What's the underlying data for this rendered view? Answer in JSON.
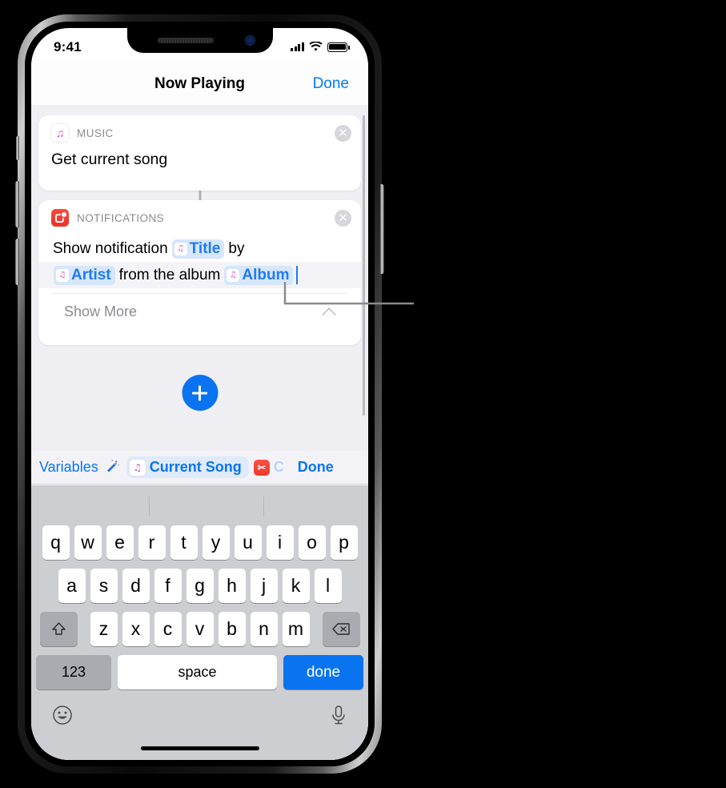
{
  "status_bar": {
    "time": "9:41",
    "signal_icon": "cellular-bars-icon",
    "wifi_icon": "wifi-icon",
    "battery_icon": "battery-full-icon"
  },
  "nav_bar": {
    "title": "Now Playing",
    "done_label": "Done"
  },
  "actions": [
    {
      "app_name": "MUSIC",
      "app_icon": "music-app-icon",
      "icon_glyph": "♫",
      "action_text": "Get current song",
      "close_label": "✕"
    },
    {
      "app_name": "NOTIFICATIONS",
      "app_icon": "notifications-app-icon",
      "close_label": "✕",
      "line1": [
        {
          "type": "text",
          "value": "Show notification"
        },
        {
          "type": "token",
          "value": "Title",
          "icon": "music-note-icon",
          "glyph": "♫"
        },
        {
          "type": "text",
          "value": "by"
        }
      ],
      "line2": [
        {
          "type": "token",
          "value": "Artist",
          "icon": "music-note-icon",
          "glyph": "♫"
        },
        {
          "type": "text",
          "value": "from the album"
        },
        {
          "type": "token",
          "value": "Album",
          "icon": "music-note-icon",
          "glyph": "♫"
        }
      ],
      "show_more_label": "Show More",
      "show_more_chevron": "chevron-up-icon"
    }
  ],
  "add_button": {
    "label": "+",
    "icon": "plus-icon"
  },
  "variables_toolbar": {
    "label": "Variables",
    "magic_wand_icon": "magic-wand-icon",
    "magic_wand_glyph": "🪄",
    "chips": [
      {
        "label": "Current Song",
        "icon": "music-note-icon",
        "glyph": "♫",
        "clipped": false
      },
      {
        "label": "C",
        "icon": "scissors-icon",
        "glyph": "✂",
        "clipped": true
      }
    ],
    "done_label": "Done"
  },
  "keyboard": {
    "row1": [
      "q",
      "w",
      "e",
      "r",
      "t",
      "y",
      "u",
      "i",
      "o",
      "p"
    ],
    "row2": [
      "a",
      "s",
      "d",
      "f",
      "g",
      "h",
      "j",
      "k",
      "l"
    ],
    "row3": [
      "z",
      "x",
      "c",
      "v",
      "b",
      "n",
      "m"
    ],
    "shift_icon": "shift-arrow-icon",
    "shift_glyph": "⇧",
    "backspace_icon": "backspace-icon",
    "backspace_glyph": "⌫",
    "numbers_label": "123",
    "space_label": "space",
    "done_label": "done",
    "emoji_icon": "emoji-smiley-icon",
    "emoji_glyph": "☺",
    "mic_icon": "microphone-icon",
    "mic_glyph": "🎤"
  },
  "colors": {
    "accent_blue": "#007aff",
    "token_blue": "#1f7bf4",
    "token_bg": "#d6e6fb",
    "notifications_red": "#ff473a",
    "keyboard_bg": "#cdced2",
    "content_bg": "#efeff4"
  }
}
